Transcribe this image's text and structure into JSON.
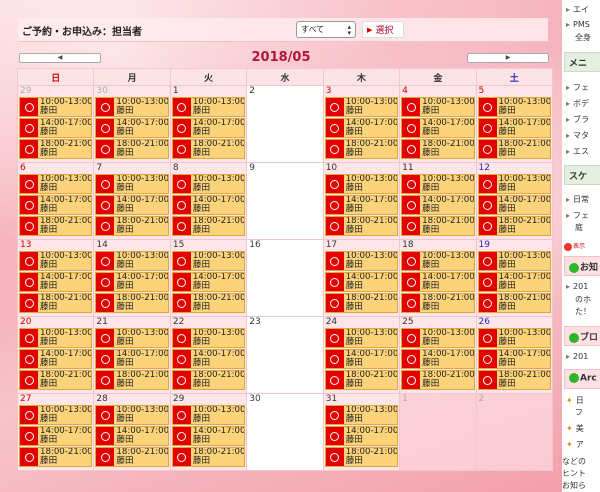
{
  "header": {
    "booking_label": "ご予約・お申込み：担当者",
    "staff_select_value": "すべて",
    "select_button_label": "選択"
  },
  "calendar": {
    "month_title": "2018/05",
    "prev_label": "◀",
    "next_label": "▶",
    "weekdays": [
      "日",
      "月",
      "火",
      "水",
      "木",
      "金",
      "土"
    ],
    "slot_times": [
      "10:00-13:00",
      "14:00-17:00",
      "18:00-21:00"
    ],
    "staff_name": "藤田",
    "weeks": [
      [
        {
          "day": "29",
          "grey": true,
          "slots": true
        },
        {
          "day": "30",
          "grey": true,
          "slots": true
        },
        {
          "day": "1",
          "slots": true
        },
        {
          "day": "2",
          "slots": false
        },
        {
          "day": "3",
          "red": true,
          "slots": true
        },
        {
          "day": "4",
          "red": true,
          "slots": true
        },
        {
          "day": "5",
          "red": true,
          "slots": true
        }
      ],
      [
        {
          "day": "6",
          "red": true,
          "slots": true
        },
        {
          "day": "7",
          "slots": true
        },
        {
          "day": "8",
          "slots": true
        },
        {
          "day": "9",
          "slots": false
        },
        {
          "day": "10",
          "slots": true
        },
        {
          "day": "11",
          "slots": true
        },
        {
          "day": "12",
          "blue": true,
          "slots": true
        }
      ],
      [
        {
          "day": "13",
          "red": true,
          "slots": true
        },
        {
          "day": "14",
          "slots": true
        },
        {
          "day": "15",
          "slots": true
        },
        {
          "day": "16",
          "slots": false
        },
        {
          "day": "17",
          "slots": true
        },
        {
          "day": "18",
          "slots": true
        },
        {
          "day": "19",
          "blue": true,
          "slots": true
        }
      ],
      [
        {
          "day": "20",
          "red": true,
          "slots": true
        },
        {
          "day": "21",
          "slots": true
        },
        {
          "day": "22",
          "slots": true
        },
        {
          "day": "23",
          "slots": false
        },
        {
          "day": "24",
          "slots": true
        },
        {
          "day": "25",
          "slots": true
        },
        {
          "day": "26",
          "blue": true,
          "slots": true
        }
      ],
      [
        {
          "day": "27",
          "red": true,
          "slots": true
        },
        {
          "day": "28",
          "slots": true
        },
        {
          "day": "29",
          "slots": true
        },
        {
          "day": "30",
          "slots": false
        },
        {
          "day": "31",
          "slots": true
        },
        {
          "day": "1",
          "grey": true,
          "slots": false
        },
        {
          "day": "2",
          "grey": true,
          "slots": false
        }
      ]
    ]
  },
  "sidebar": {
    "items": [
      {
        "text": "エイ"
      },
      {
        "text": "PMS"
      },
      {
        "text": "全身"
      },
      {
        "text": "メニ"
      },
      {
        "text": "フェ"
      },
      {
        "text": "ボデ"
      },
      {
        "text": "ブラ"
      },
      {
        "text": "マタ"
      },
      {
        "text": "エス"
      },
      {
        "text": "スケ"
      },
      {
        "text": "日常"
      },
      {
        "text": "フェ"
      },
      {
        "text": "庭"
      },
      {
        "text": "表示"
      },
      {
        "text": "お知"
      },
      {
        "text": "201"
      },
      {
        "text": "のホ"
      },
      {
        "text": "た！"
      },
      {
        "text": "ブロ"
      },
      {
        "text": "201"
      },
      {
        "text": "Arc"
      },
      {
        "text": "日"
      },
      {
        "text": "フ"
      },
      {
        "text": "美"
      },
      {
        "text": "ア"
      },
      {
        "text": "などの"
      },
      {
        "text": "ヒント"
      },
      {
        "text": "お知ら"
      }
    ]
  },
  "colors": {
    "slot_bg": "#fbd37a",
    "slot_mark": "#e30000",
    "month_title": "#b3143a",
    "sunday": "#d40000",
    "saturday": "#2a2ab8"
  }
}
